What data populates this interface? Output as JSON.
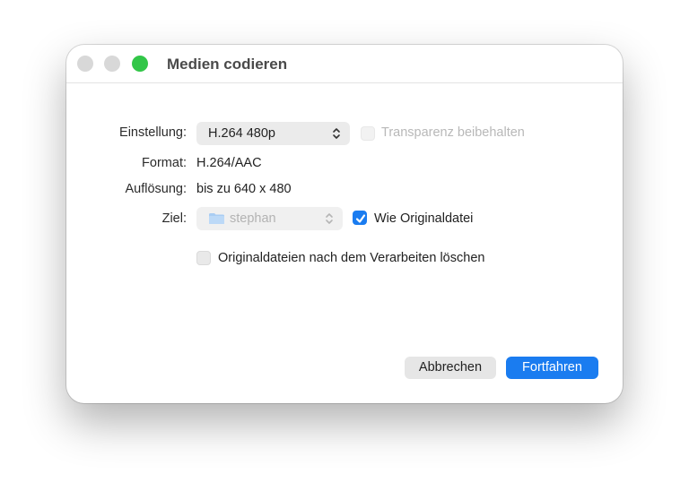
{
  "window": {
    "title": "Medien codieren"
  },
  "form": {
    "setting_label": "Einstellung:",
    "setting_value": "H.264 480p",
    "transparency_label": "Transparenz beibehalten",
    "format_label": "Format:",
    "format_value": "H.264/AAC",
    "resolution_label": "Auflösung:",
    "resolution_value": "bis zu 640 x 480",
    "target_label": "Ziel:",
    "target_value": "stephan",
    "same_as_original_label": "Wie Originaldatei",
    "same_as_original_checked": true,
    "delete_originals_label": "Originaldateien nach dem Verarbeiten löschen",
    "delete_originals_checked": false,
    "transparency_checked": false
  },
  "buttons": {
    "cancel_label": "Abbrechen",
    "continue_label": "Fortfahren"
  },
  "colors": {
    "accent": "#1a7cf0",
    "zoom_light": "#32c648"
  },
  "icons": {
    "popup_arrows": "updown-chevron-icon",
    "target_folder": "folder-icon",
    "checkmark": "checkmark-icon"
  }
}
